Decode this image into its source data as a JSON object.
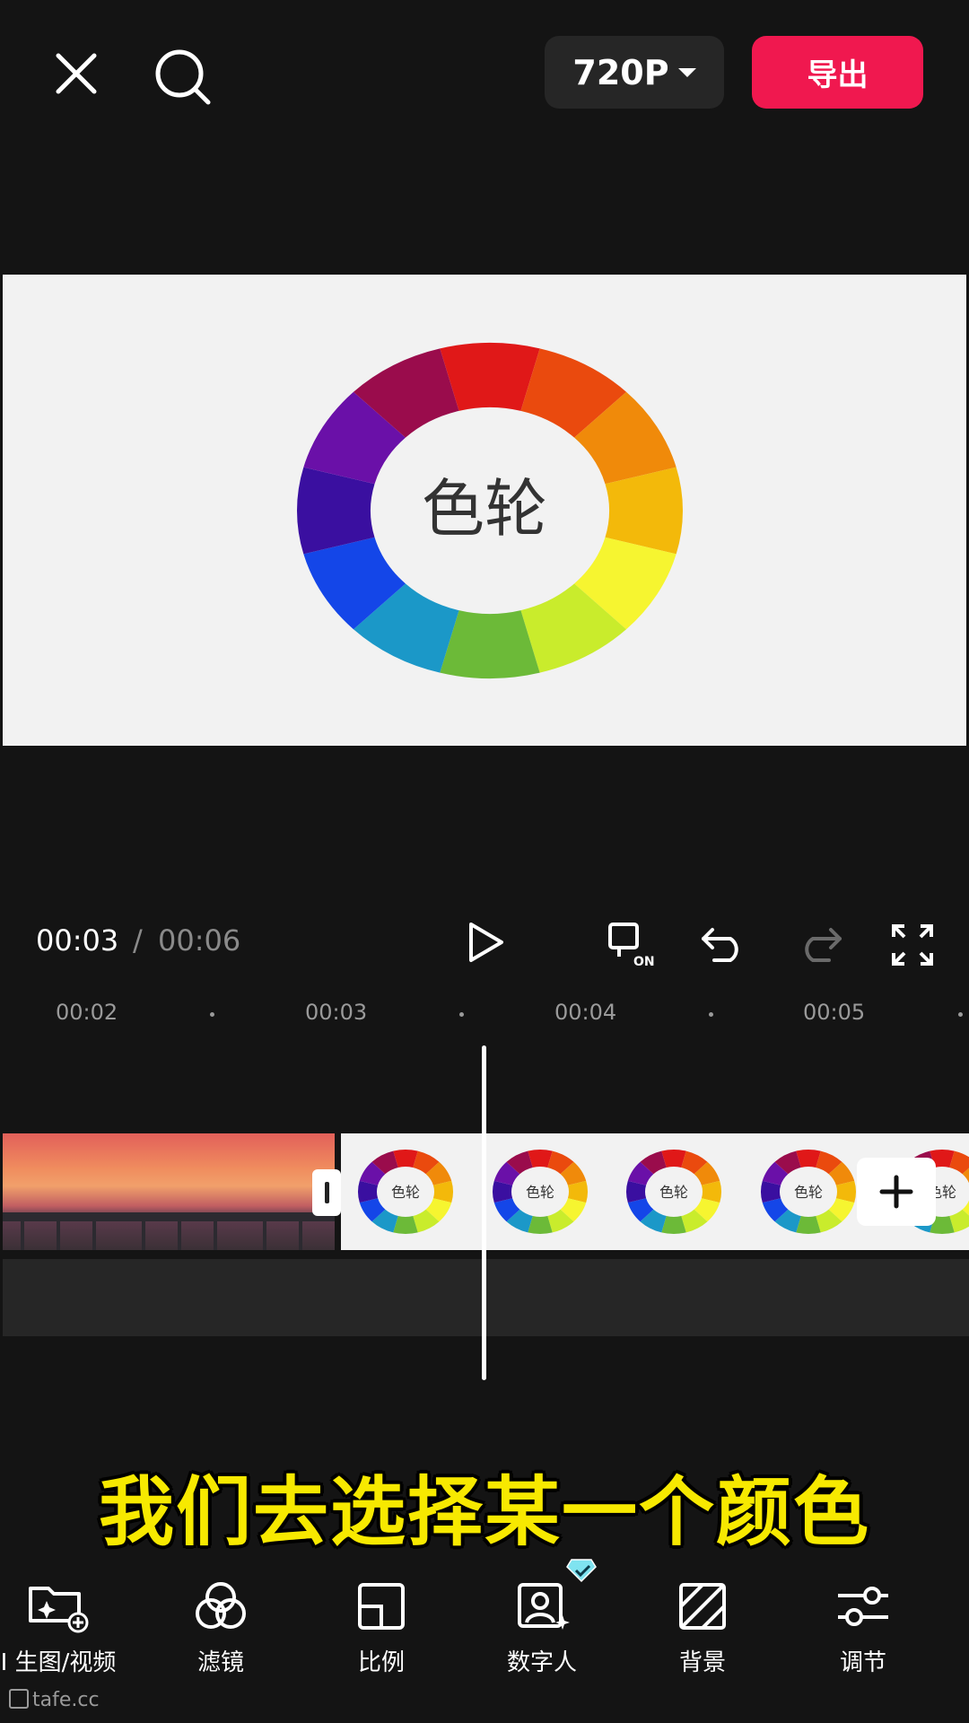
{
  "header": {
    "resolution_label": "720P",
    "export_label": "导出"
  },
  "preview": {
    "wheel_text": "色轮",
    "wheel_colors": [
      "#e01818",
      "#ea4a0e",
      "#f08a0a",
      "#f3b90a",
      "#f6f530",
      "#c9ec2c",
      "#6cba38",
      "#1b98c8",
      "#1446e8",
      "#3a0fa0",
      "#6a10a8",
      "#9a0c4c"
    ]
  },
  "playback": {
    "current_time": "00:03",
    "separator": "/",
    "total_time": "00:06"
  },
  "ruler": {
    "ticks": [
      "00:02",
      "00:03",
      "00:04",
      "00:05"
    ]
  },
  "track": {
    "thumb_text": "色轮"
  },
  "subtitle": "我们去选择某一个颜色",
  "toolbar": {
    "items": [
      {
        "label": "I 生图/视频",
        "icon": "add-media-icon"
      },
      {
        "label": "滤镜",
        "icon": "filter-icon"
      },
      {
        "label": "比例",
        "icon": "ratio-icon"
      },
      {
        "label": "数字人",
        "icon": "avatar-icon"
      },
      {
        "label": "背景",
        "icon": "background-icon"
      },
      {
        "label": "调节",
        "icon": "adjust-icon"
      }
    ]
  },
  "watermark": "tafe.cc"
}
